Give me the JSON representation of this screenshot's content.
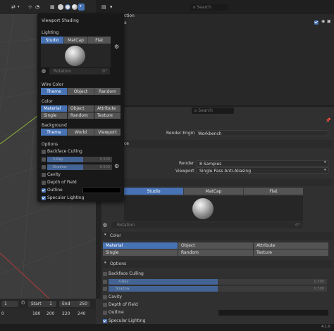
{
  "topbar": {
    "menu_partial": "Viewport Shading"
  },
  "outliner": {
    "item1": "ction",
    "item2": "a",
    "search_placeholder": "Search"
  },
  "popover": {
    "title": "Viewport Shading",
    "lighting_label": "Lighting",
    "lighting_options": [
      "Studio",
      "MatCap",
      "Flat"
    ],
    "lighting_selected": "Studio",
    "rotation_label": "Rotation",
    "rotation_value": "0°",
    "wire_color_label": "Wire Color",
    "wire_options": [
      "Theme",
      "Object",
      "Random"
    ],
    "wire_selected": "Theme",
    "color_label": "Color",
    "color_options": [
      "Material",
      "Object",
      "Attribute",
      "Single",
      "Random",
      "Texture"
    ],
    "color_selected": "Material",
    "background_label": "Background",
    "background_options": [
      "Theme",
      "World",
      "Viewport"
    ],
    "background_selected": "Theme",
    "options_label": "Options",
    "backface_culling": "Backface Culling",
    "xray_label": "X-Ray",
    "xray_value": "0.500",
    "shadow_label": "Shadow",
    "shadow_value": "0.500",
    "cavity": "Cavity",
    "depth_of_field": "Depth of Field",
    "outline": "Outline",
    "specular_lighting": "Specular Lighting"
  },
  "properties": {
    "search_placeholder": "Search",
    "render_engine_label": "Render Engine",
    "render_engine_value": "Workbench",
    "section_partial": "ce",
    "render_label": "Render",
    "render_value": "8 Samples",
    "viewport_label": "Viewport",
    "viewport_value": "Single Pass Anti-Aliasing",
    "lighting_options": [
      "Studio",
      "MatCap",
      "Flat"
    ],
    "lighting_selected": "Studio",
    "rotation_label": "Rotation",
    "rotation_value": "0°",
    "color_header": "Color",
    "color_options": [
      "Material",
      "Object",
      "Attribute",
      "Single",
      "Random",
      "Texture"
    ],
    "color_selected": "Material",
    "options_header": "Options",
    "backface_culling": "Backface Culling",
    "xray_label": "X-Ray",
    "xray_value": "0.500",
    "shadow_label": "Shadow",
    "shadow_value": "0.500",
    "cavity": "Cavity",
    "depth_of_field": "Depth of Field",
    "outline": "Outline",
    "specular_lighting": "Specular Lighting"
  },
  "timeline": {
    "frame_current": "1",
    "start_label": "Start",
    "start_value": "1",
    "end_label": "End",
    "end_value": "250",
    "ticks": [
      "0",
      "180",
      "200",
      "220",
      "240"
    ]
  },
  "status": {
    "version": "4.1.0"
  },
  "colors": {
    "accent": "#4772b3",
    "panel": "#303030",
    "popover": "#181818"
  }
}
